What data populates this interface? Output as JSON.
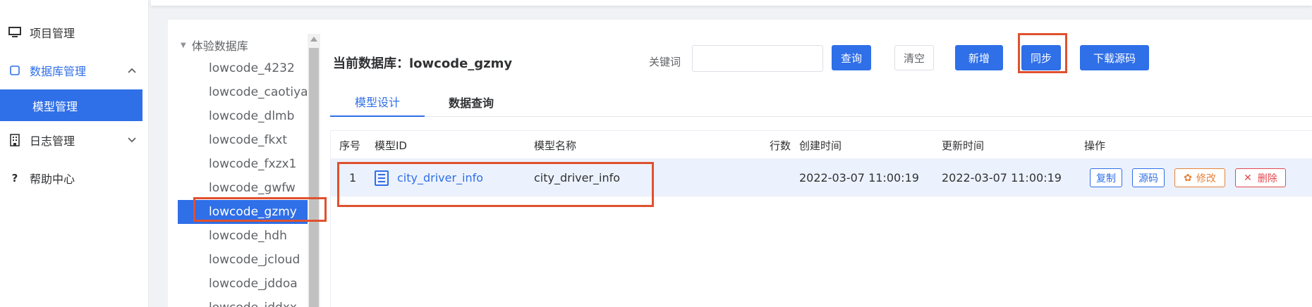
{
  "sidebar": {
    "items": [
      {
        "label": "项目管理",
        "icon": "monitor-icon"
      },
      {
        "label": "数据库管理",
        "icon": "checkbox-icon",
        "expanded": true
      },
      {
        "label": "日志管理",
        "icon": "building-icon",
        "expanded": false
      },
      {
        "label": "帮助中心",
        "icon": "question-icon"
      }
    ],
    "sub_item": "模型管理"
  },
  "tree": {
    "root": "体验数据库",
    "nodes": [
      "lowcode_4232",
      "lowcode_caotiyan",
      "lowcode_dlmb",
      "lowcode_fkxt",
      "lowcode_fxzx1",
      "lowcode_gwfw",
      "lowcode_gzmy",
      "lowcode_hdh",
      "lowcode_jcloud",
      "lowcode_jddoa",
      "lowcode_jddxx"
    ],
    "selected": "lowcode_gzmy"
  },
  "header": {
    "current_db_label": "当前数据库：lowcode_gzmy",
    "keyword_label": "关键词",
    "keyword_value": "",
    "buttons": {
      "query": "查询",
      "clear": "清空",
      "add": "新增",
      "sync": "同步",
      "download": "下载源码"
    }
  },
  "tabs": [
    {
      "label": "模型设计",
      "active": true
    },
    {
      "label": "数据查询",
      "active": false
    }
  ],
  "table": {
    "columns": [
      "序号",
      "模型ID",
      "模型名称",
      "行数",
      "创建时间",
      "更新时间",
      "操作"
    ],
    "rows": [
      {
        "index": "1",
        "model_id": "city_driver_info",
        "model_name": "city_driver_info",
        "row_count": "",
        "created": "2022-03-07 11:00:19",
        "updated": "2022-03-07 11:00:19",
        "actions": {
          "copy": "复制",
          "source": "源码",
          "edit": "修改",
          "delete": "删除"
        }
      }
    ]
  },
  "colors": {
    "primary": "#2f6fe8",
    "highlight": "#e0512e",
    "row_bg": "#ecf2fd",
    "edit": "#e6823a",
    "delete": "#e5484d"
  }
}
